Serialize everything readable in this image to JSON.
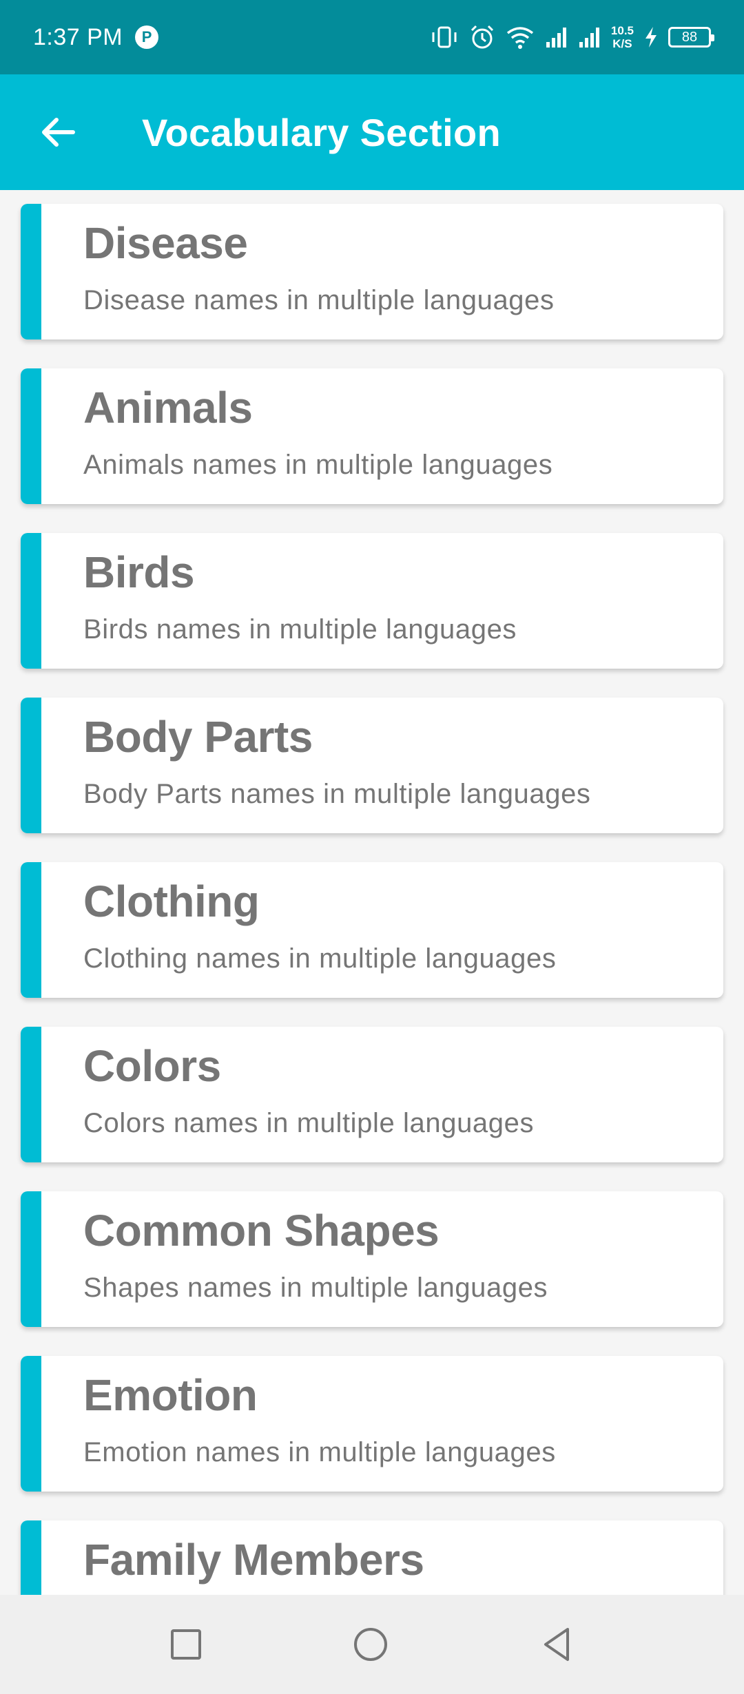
{
  "status_bar": {
    "time": "1:37 PM",
    "speed_value": "10.5",
    "speed_unit": "K/S",
    "battery": "88",
    "icons": [
      "vibrate-icon",
      "alarm-icon",
      "wifi-icon",
      "signal-icon",
      "signal-icon",
      "charging-icon",
      "battery-icon"
    ]
  },
  "app_bar": {
    "title": "Vocabulary Section",
    "back_icon": "arrow-left-icon"
  },
  "categories": [
    {
      "title": "Disease",
      "subtitle": "Disease names in multiple languages"
    },
    {
      "title": "Animals",
      "subtitle": "Animals names in multiple languages"
    },
    {
      "title": "Birds",
      "subtitle": "Birds names in multiple languages"
    },
    {
      "title": "Body Parts",
      "subtitle": "Body Parts names in multiple languages"
    },
    {
      "title": "Clothing",
      "subtitle": "Clothing names in multiple languages"
    },
    {
      "title": "Colors",
      "subtitle": "Colors names in multiple languages"
    },
    {
      "title": "Common Shapes",
      "subtitle": "Shapes names in multiple languages"
    },
    {
      "title": "Emotion",
      "subtitle": "Emotion names in multiple languages"
    },
    {
      "title": "Family Members",
      "subtitle": ""
    }
  ],
  "colors": {
    "status_bar": "#038c9a",
    "app_bar": "#00bcd4",
    "accent": "#00bcd4",
    "card_text": "#757575",
    "nav_bar": "#efefef"
  },
  "nav_bar": {
    "icons": [
      "recents-square-icon",
      "home-circle-icon",
      "back-triangle-icon"
    ]
  }
}
